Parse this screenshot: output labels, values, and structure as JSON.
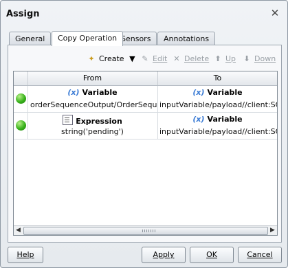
{
  "dialog": {
    "title": "Assign"
  },
  "tabs": [
    {
      "label": "General"
    },
    {
      "label": "Copy Operation"
    },
    {
      "label": "Sensors"
    },
    {
      "label": "Annotations"
    }
  ],
  "toolbar": {
    "create": "Create",
    "edit": "Edit",
    "delete": "Delete",
    "up": "Up",
    "down": "Down"
  },
  "table": {
    "columns": [
      "From",
      "To"
    ],
    "rows": [
      {
        "from_type": "Variable",
        "from_value": "orderSequenceOutput/OrderSeque...",
        "to_type": "Variable",
        "to_value": "inputVariable/payload//client:SOAOr"
      },
      {
        "from_type": "Expression",
        "from_value": "string('pending')",
        "to_type": "Variable",
        "to_value": "inputVariable/payload//client:SOAOr"
      }
    ]
  },
  "footer": {
    "help": "Help",
    "apply": "Apply",
    "ok": "OK",
    "cancel": "Cancel"
  }
}
